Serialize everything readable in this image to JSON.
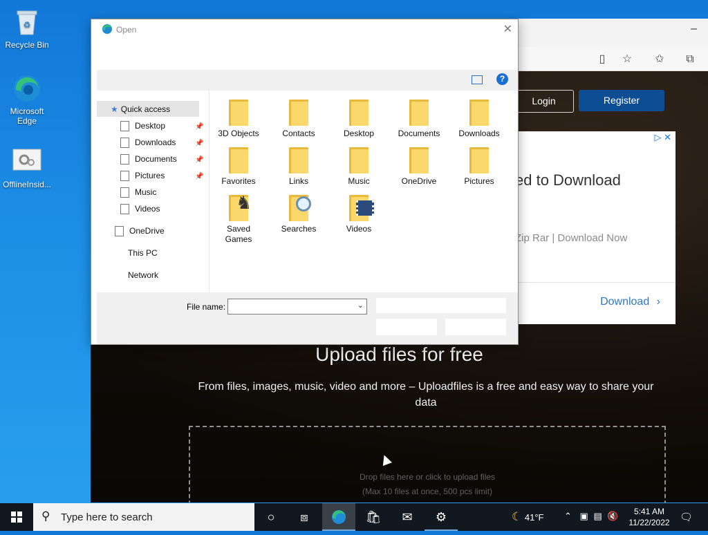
{
  "desktop": {
    "icons": [
      {
        "label": "Recycle Bin"
      },
      {
        "label": "Microsoft Edge"
      },
      {
        "label": "OfflineInsid..."
      }
    ]
  },
  "browser": {
    "login_label": "Login",
    "register_label": "Register",
    "ad": {
      "headline": "ed to Download",
      "sub": "Zip Rar | Download Now",
      "cta": "Download",
      "cta_chevron": "›",
      "adchoices": "▷ ✕"
    },
    "page": {
      "upload_title": "Upload files for free",
      "upload_sub": "From files, images, music, video and more – Uploadfiles is a free and easy way to share your data",
      "dropzone_line1": "Drop files here or click to upload files",
      "dropzone_line2": "(Max 10 files at once, 500 pcs limit)"
    }
  },
  "dialog": {
    "title": "Open",
    "close_glyph": "✕",
    "help_glyph": "?",
    "nav": [
      {
        "label": "Quick access",
        "pinned": false
      },
      {
        "label": "Desktop",
        "pinned": true
      },
      {
        "label": "Downloads",
        "pinned": true
      },
      {
        "label": "Documents",
        "pinned": true
      },
      {
        "label": "Pictures",
        "pinned": true
      },
      {
        "label": "Music",
        "pinned": false
      },
      {
        "label": "Videos",
        "pinned": false
      },
      {
        "label": "OneDrive",
        "pinned": false
      },
      {
        "label": "This PC",
        "pinned": false
      },
      {
        "label": "Network",
        "pinned": false
      }
    ],
    "files": [
      {
        "label": "3D Objects"
      },
      {
        "label": "Contacts"
      },
      {
        "label": "Desktop"
      },
      {
        "label": "Documents"
      },
      {
        "label": "Downloads"
      },
      {
        "label": "Favorites"
      },
      {
        "label": "Links"
      },
      {
        "label": "Music"
      },
      {
        "label": "OneDrive"
      },
      {
        "label": "Pictures"
      },
      {
        "label": "Saved Games"
      },
      {
        "label": "Searches"
      },
      {
        "label": "Videos"
      }
    ],
    "filename_label": "File name:",
    "filename_value": "",
    "dropdown_glyph": "⌄"
  },
  "taskbar": {
    "search_placeholder": "Type here to search",
    "weather": "41°F",
    "time": "5:41 AM",
    "date": "11/22/2022"
  },
  "colors": {
    "desktop_blue": "#1d8fe6",
    "register_blue": "#0d4d94",
    "link_blue": "#2d78c8",
    "taskbar": "#12181f"
  }
}
